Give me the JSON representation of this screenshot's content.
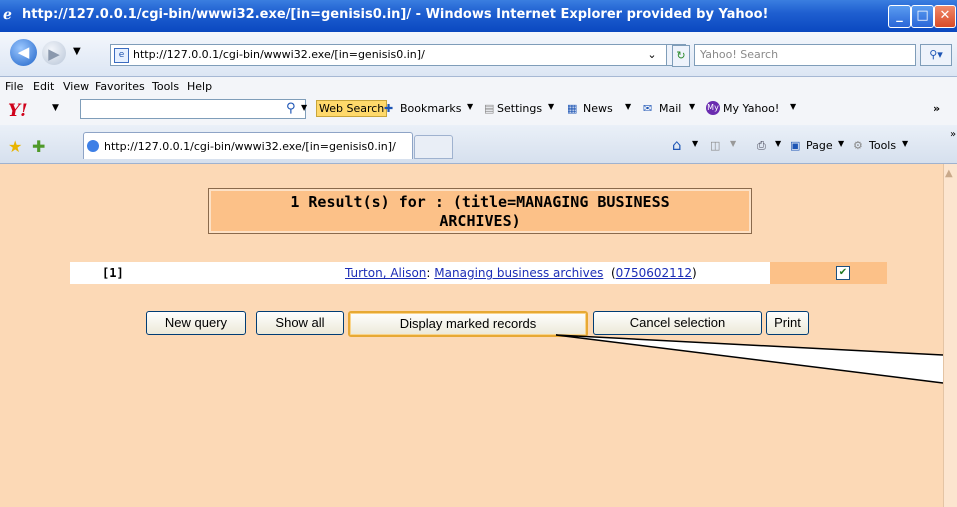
{
  "window": {
    "title": "http://127.0.0.1/cgi-bin/wwwi32.exe/[in=genisis0.in]/ - Windows Internet Explorer provided by Yahoo!"
  },
  "address_bar": {
    "url": "http://127.0.0.1/cgi-bin/wwwi32.exe/[in=genisis0.in]/"
  },
  "search_box": {
    "placeholder": "Yahoo! Search"
  },
  "menu": [
    "File",
    "Edit",
    "View",
    "Favorites",
    "Tools",
    "Help"
  ],
  "yahoo_toolbar": {
    "web_search": "Web Search",
    "bookmarks": "Bookmarks",
    "settings": "Settings",
    "news": "News",
    "mail": "Mail",
    "my_yahoo": "My Yahoo!"
  },
  "tab": {
    "label": "http://127.0.0.1/cgi-bin/wwwi32.exe/[in=genisis0.in]/"
  },
  "command_bar": {
    "page": "Page",
    "tools": "Tools"
  },
  "results": {
    "heading_line1": "1 Result(s) for : (title=MANAGING BUSINESS",
    "heading_line2": "ARCHIVES)"
  },
  "record": {
    "index": "[1]",
    "author": "Turton, Alison",
    "separator": ":",
    "title": "Managing business archives",
    "isbn": "0750602112",
    "marked": true
  },
  "buttons": {
    "new_query": "New query",
    "show_all": "Show all",
    "display_marked": "Display marked records",
    "cancel_selection": "Cancel selection",
    "print": "Print"
  },
  "colors": {
    "page_background": "#fcd9b6",
    "result_box": "#fcc188",
    "link": "#1c2eb6",
    "titlebar": "#0a48c0"
  }
}
